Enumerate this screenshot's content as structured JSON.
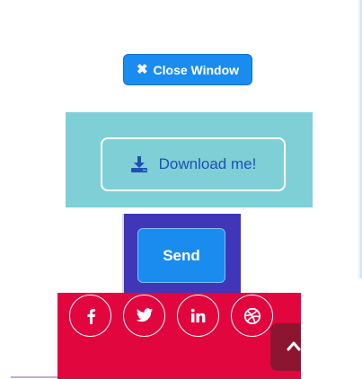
{
  "close_button": {
    "label": "Close Window",
    "icon": "times-icon"
  },
  "download_button": {
    "label": "Download me!",
    "icon": "download-icon"
  },
  "send_button": {
    "label": "Send"
  },
  "social_links": [
    {
      "name": "facebook",
      "icon": "facebook-icon"
    },
    {
      "name": "twitter",
      "icon": "twitter-icon"
    },
    {
      "name": "linkedin",
      "icon": "linkedin-icon"
    },
    {
      "name": "dribbble",
      "icon": "dribbble-icon"
    }
  ],
  "back_to_top": {
    "icon": "chevron-up-icon"
  },
  "colors": {
    "primary_blue": "#1a8cf0",
    "teal": "#7fcfd6",
    "purple": "#3f36b8",
    "crimson": "#e2063f",
    "dark_crimson": "#8c1631",
    "download_text": "#1f4fb5"
  }
}
